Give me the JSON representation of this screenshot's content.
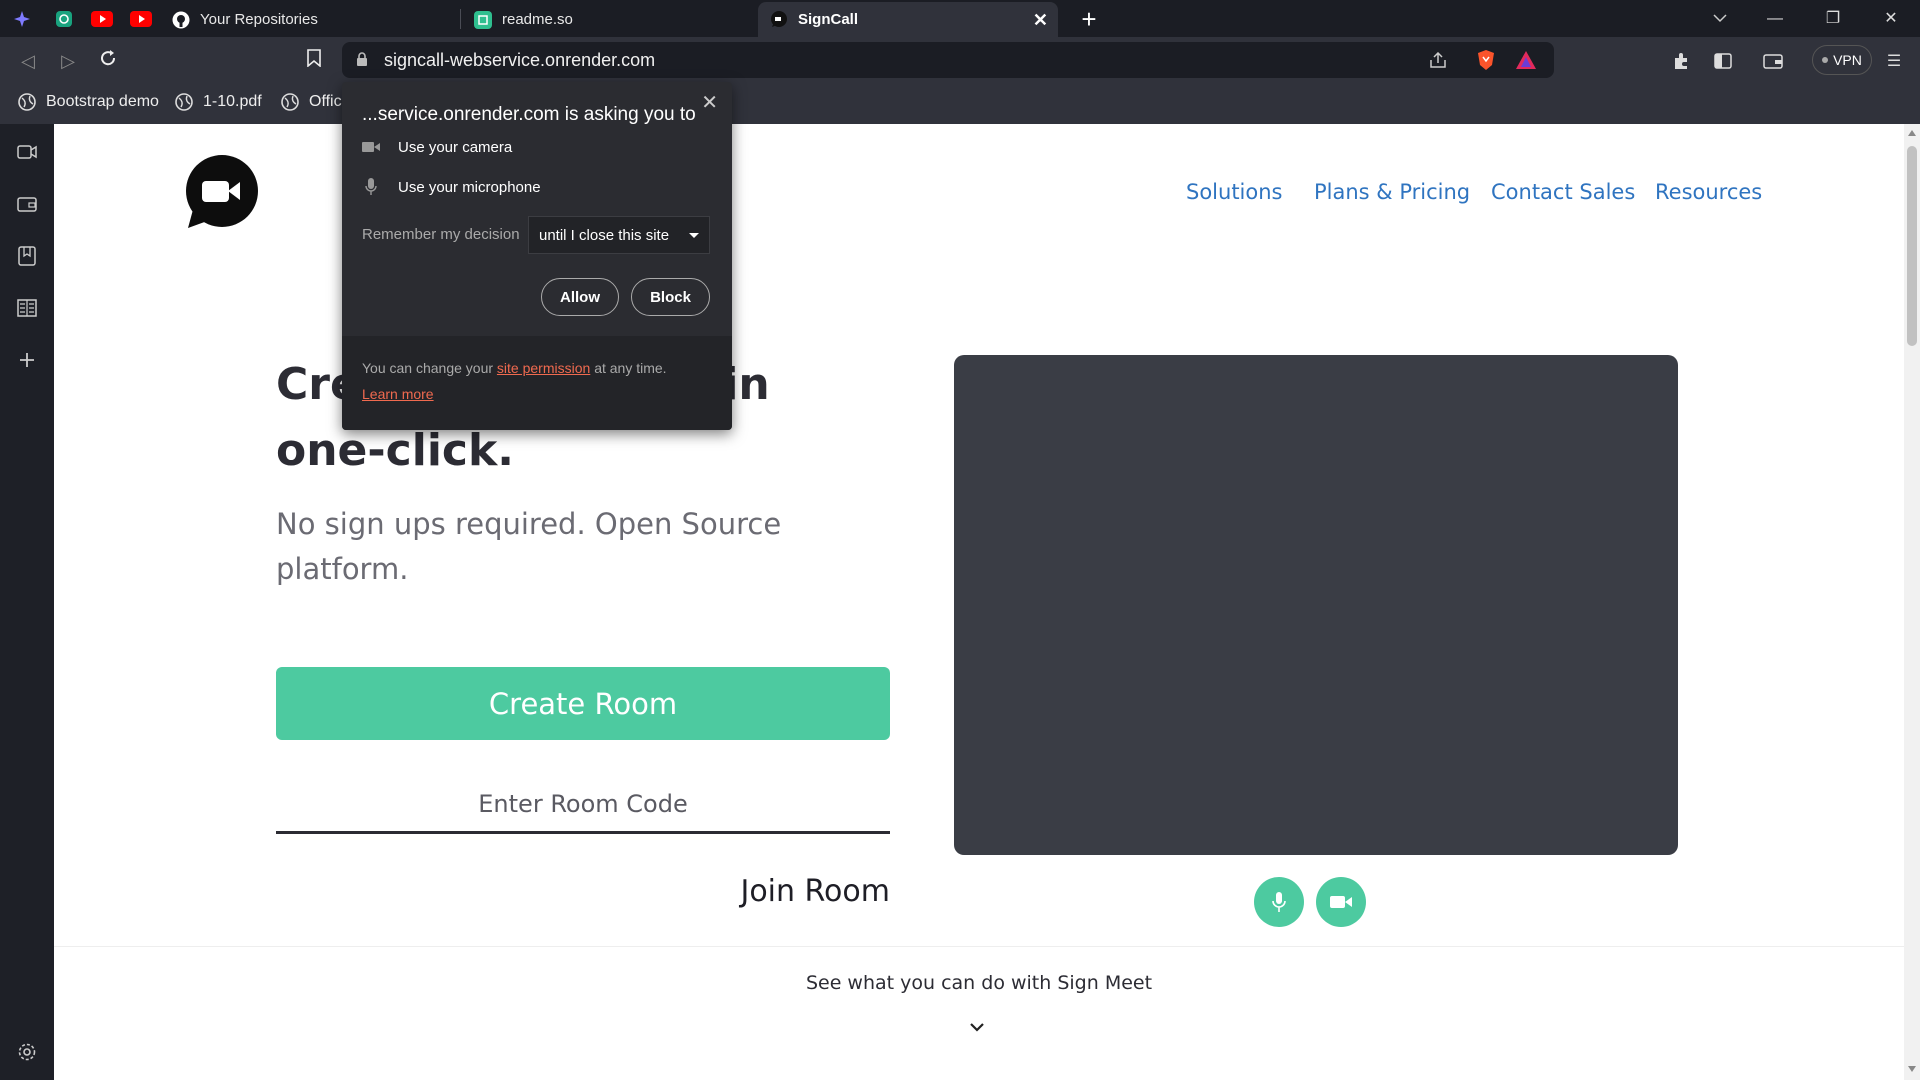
{
  "browser": {
    "tabs": [
      {
        "title": "Your Repositories"
      },
      {
        "title": "readme.so"
      },
      {
        "title": "SignCall"
      }
    ],
    "address": "signcall-webservice.onrender.com",
    "vpn_label": "VPN",
    "bookmarks": [
      {
        "label": "Bootstrap demo"
      },
      {
        "label": "1-10.pdf"
      },
      {
        "label": "Offic"
      }
    ]
  },
  "permission_popup": {
    "title": "...service.onrender.com is asking you to",
    "camera": "Use your camera",
    "microphone": "Use your microphone",
    "remember_label": "Remember my decision",
    "remember_value": "until I close this site",
    "allow": "Allow",
    "block": "Block",
    "footer_prefix": "You can change your",
    "footer_link": "site permission",
    "footer_suffix": "at any time.",
    "learn_more": "Learn more"
  },
  "page": {
    "nav": [
      "Solutions",
      "Plans & Pricing",
      "Contact Sales",
      "Resources"
    ],
    "hero_title_visible_start": "Cre",
    "hero_title_visible_end": "s in",
    "hero_title_line2": "one-click.",
    "hero_subtitle": "No sign ups required. Open Source platform.",
    "create_room": "Create Room",
    "room_code_placeholder": "Enter Room Code",
    "join_room": "Join Room",
    "see_what": "See what you can do with Sign Meet"
  },
  "colors": {
    "accent": "#4dcaa0",
    "nav_link": "#2f74c0",
    "video_bg": "#3a3d45",
    "popup_link": "#f06a4f"
  }
}
